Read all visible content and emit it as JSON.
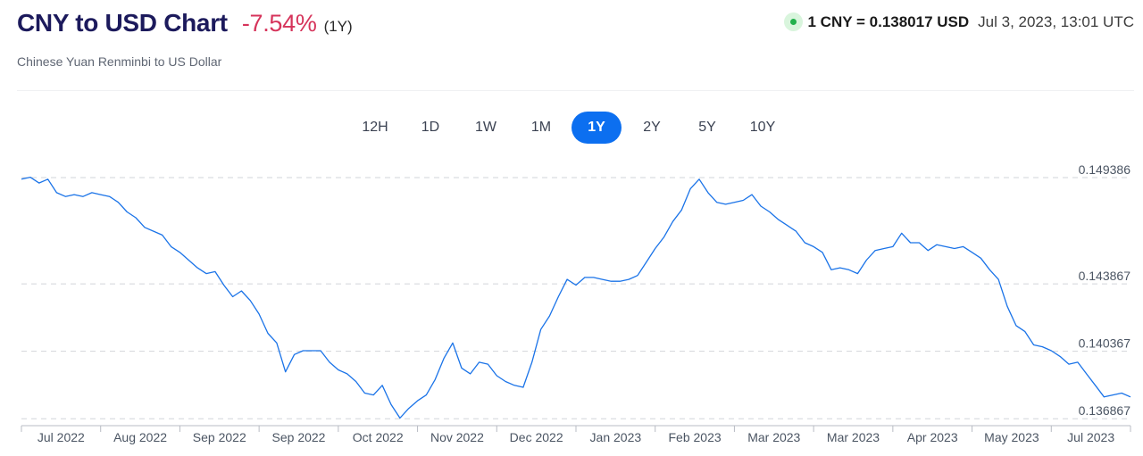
{
  "header": {
    "title": "CNY to USD Chart",
    "change": "-7.54%",
    "period": "(1Y)",
    "subtitle": "Chinese Yuan Renminbi to US Dollar",
    "live_rate": "1 CNY = 0.138017 USD",
    "timestamp": "Jul 3, 2023, 13:01 UTC"
  },
  "colors": {
    "title": "#1c1a5c",
    "negative_change": "#d6345b",
    "accent": "#0c6ff0",
    "line": "#1a73e8",
    "live_indicator": "#22b14c"
  },
  "tabs": [
    {
      "label": "12H",
      "active": false
    },
    {
      "label": "1D",
      "active": false
    },
    {
      "label": "1W",
      "active": false
    },
    {
      "label": "1M",
      "active": false
    },
    {
      "label": "1Y",
      "active": true
    },
    {
      "label": "2Y",
      "active": false
    },
    {
      "label": "5Y",
      "active": false
    },
    {
      "label": "10Y",
      "active": false
    }
  ],
  "chart_data": {
    "type": "line",
    "x_tick_labels": [
      "Jul 2022",
      "Aug 2022",
      "Sep 2022",
      "Sep 2022",
      "Oct 2022",
      "Nov 2022",
      "Dec 2022",
      "Jan 2023",
      "Feb 2023",
      "Mar 2023",
      "Mar 2023",
      "Apr 2023",
      "May 2023",
      "Jul 2023"
    ],
    "y_tick_labels": [
      "0.149386",
      "0.143867",
      "0.140367",
      "0.136867"
    ],
    "y_ticks": [
      0.149386,
      0.143867,
      0.140367,
      0.136867
    ],
    "ylim": [
      0.1366,
      0.1498
    ],
    "grid": true,
    "series": [
      {
        "values": [
          0.1493,
          0.1494,
          0.1491,
          0.1493,
          0.1486,
          0.1484,
          0.1485,
          0.1484,
          0.1486,
          0.1485,
          0.1484,
          0.1481,
          0.1476,
          0.1473,
          0.1468,
          0.1466,
          0.1464,
          0.1458,
          0.1455,
          0.1451,
          0.1447,
          0.1444,
          0.1445,
          0.1438,
          0.1432,
          0.1435,
          0.143,
          0.1423,
          0.1413,
          0.1408,
          0.1393,
          0.1402,
          0.1404,
          0.1404,
          0.1404,
          0.1398,
          0.1394,
          0.1392,
          0.1388,
          0.1382,
          0.1381,
          0.1386,
          0.1376,
          0.1369,
          0.1374,
          0.1378,
          0.1381,
          0.1389,
          0.14,
          0.1408,
          0.1395,
          0.1392,
          0.1398,
          0.1397,
          0.1391,
          0.1388,
          0.1386,
          0.1385,
          0.1398,
          0.1415,
          0.1422,
          0.1432,
          0.1441,
          0.1438,
          0.1442,
          0.1442,
          0.1441,
          0.144,
          0.144,
          0.1441,
          0.1443,
          0.145,
          0.1457,
          0.1463,
          0.1471,
          0.1477,
          0.1488,
          0.1493,
          0.1486,
          0.1481,
          0.148,
          0.1481,
          0.1482,
          0.1485,
          0.1479,
          0.1476,
          0.1472,
          0.1469,
          0.1466,
          0.146,
          0.1458,
          0.1455,
          0.1446,
          0.1447,
          0.1446,
          0.1444,
          0.1451,
          0.1456,
          0.1457,
          0.1458,
          0.1465,
          0.146,
          0.146,
          0.1456,
          0.1459,
          0.1458,
          0.1457,
          0.1458,
          0.1455,
          0.1452,
          0.1446,
          0.1441,
          0.1427,
          0.1417,
          0.1414,
          0.1407,
          0.1406,
          0.1404,
          0.1401,
          0.1397,
          0.1398,
          0.1392,
          0.1386,
          0.138,
          0.1381,
          0.1382,
          0.138
        ]
      }
    ]
  }
}
